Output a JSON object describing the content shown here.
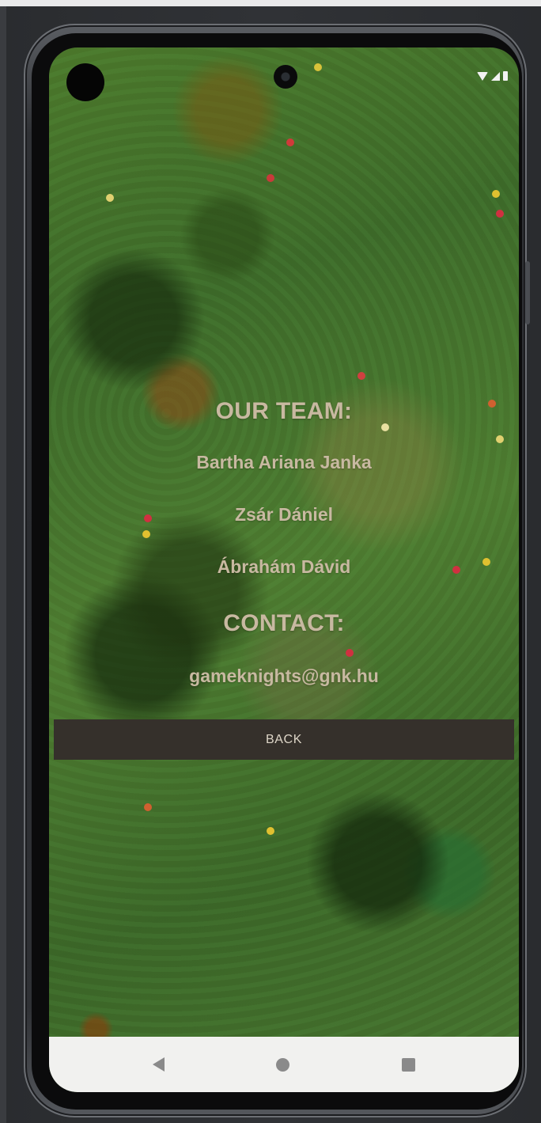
{
  "screen": {
    "team_heading": "OUR TEAM:",
    "members": [
      "Bartha Ariana Janka",
      "Zsár Dániel",
      "Ábrahám Dávid"
    ],
    "contact_heading": "CONTACT:",
    "email": "gameknights@gnk.hu",
    "back_button": "BACK"
  },
  "status_bar": {
    "icons": [
      "wifi-icon",
      "signal-icon",
      "battery-icon"
    ]
  },
  "nav_bar": {
    "icons": [
      "nav-back-icon",
      "nav-home-icon",
      "nav-recents-icon"
    ]
  },
  "colors": {
    "text": "#c8b9a1",
    "button_bg": "#35302b",
    "button_text": "#ded6c8",
    "nav_bg": "#f1f1ef"
  }
}
